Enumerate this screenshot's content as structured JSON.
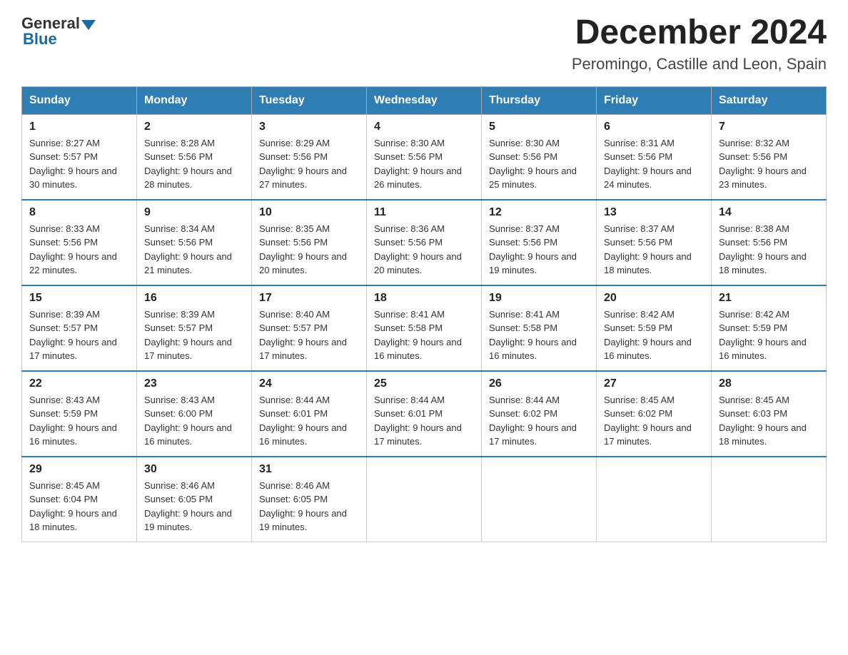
{
  "logo": {
    "general": "General",
    "blue": "Blue"
  },
  "title": "December 2024",
  "subtitle": "Peromingo, Castille and Leon, Spain",
  "days_of_week": [
    "Sunday",
    "Monday",
    "Tuesday",
    "Wednesday",
    "Thursday",
    "Friday",
    "Saturday"
  ],
  "weeks": [
    [
      {
        "day": "1",
        "sunrise": "8:27 AM",
        "sunset": "5:57 PM",
        "daylight": "9 hours and 30 minutes."
      },
      {
        "day": "2",
        "sunrise": "8:28 AM",
        "sunset": "5:56 PM",
        "daylight": "9 hours and 28 minutes."
      },
      {
        "day": "3",
        "sunrise": "8:29 AM",
        "sunset": "5:56 PM",
        "daylight": "9 hours and 27 minutes."
      },
      {
        "day": "4",
        "sunrise": "8:30 AM",
        "sunset": "5:56 PM",
        "daylight": "9 hours and 26 minutes."
      },
      {
        "day": "5",
        "sunrise": "8:30 AM",
        "sunset": "5:56 PM",
        "daylight": "9 hours and 25 minutes."
      },
      {
        "day": "6",
        "sunrise": "8:31 AM",
        "sunset": "5:56 PM",
        "daylight": "9 hours and 24 minutes."
      },
      {
        "day": "7",
        "sunrise": "8:32 AM",
        "sunset": "5:56 PM",
        "daylight": "9 hours and 23 minutes."
      }
    ],
    [
      {
        "day": "8",
        "sunrise": "8:33 AM",
        "sunset": "5:56 PM",
        "daylight": "9 hours and 22 minutes."
      },
      {
        "day": "9",
        "sunrise": "8:34 AM",
        "sunset": "5:56 PM",
        "daylight": "9 hours and 21 minutes."
      },
      {
        "day": "10",
        "sunrise": "8:35 AM",
        "sunset": "5:56 PM",
        "daylight": "9 hours and 20 minutes."
      },
      {
        "day": "11",
        "sunrise": "8:36 AM",
        "sunset": "5:56 PM",
        "daylight": "9 hours and 20 minutes."
      },
      {
        "day": "12",
        "sunrise": "8:37 AM",
        "sunset": "5:56 PM",
        "daylight": "9 hours and 19 minutes."
      },
      {
        "day": "13",
        "sunrise": "8:37 AM",
        "sunset": "5:56 PM",
        "daylight": "9 hours and 18 minutes."
      },
      {
        "day": "14",
        "sunrise": "8:38 AM",
        "sunset": "5:56 PM",
        "daylight": "9 hours and 18 minutes."
      }
    ],
    [
      {
        "day": "15",
        "sunrise": "8:39 AM",
        "sunset": "5:57 PM",
        "daylight": "9 hours and 17 minutes."
      },
      {
        "day": "16",
        "sunrise": "8:39 AM",
        "sunset": "5:57 PM",
        "daylight": "9 hours and 17 minutes."
      },
      {
        "day": "17",
        "sunrise": "8:40 AM",
        "sunset": "5:57 PM",
        "daylight": "9 hours and 17 minutes."
      },
      {
        "day": "18",
        "sunrise": "8:41 AM",
        "sunset": "5:58 PM",
        "daylight": "9 hours and 16 minutes."
      },
      {
        "day": "19",
        "sunrise": "8:41 AM",
        "sunset": "5:58 PM",
        "daylight": "9 hours and 16 minutes."
      },
      {
        "day": "20",
        "sunrise": "8:42 AM",
        "sunset": "5:59 PM",
        "daylight": "9 hours and 16 minutes."
      },
      {
        "day": "21",
        "sunrise": "8:42 AM",
        "sunset": "5:59 PM",
        "daylight": "9 hours and 16 minutes."
      }
    ],
    [
      {
        "day": "22",
        "sunrise": "8:43 AM",
        "sunset": "5:59 PM",
        "daylight": "9 hours and 16 minutes."
      },
      {
        "day": "23",
        "sunrise": "8:43 AM",
        "sunset": "6:00 PM",
        "daylight": "9 hours and 16 minutes."
      },
      {
        "day": "24",
        "sunrise": "8:44 AM",
        "sunset": "6:01 PM",
        "daylight": "9 hours and 16 minutes."
      },
      {
        "day": "25",
        "sunrise": "8:44 AM",
        "sunset": "6:01 PM",
        "daylight": "9 hours and 17 minutes."
      },
      {
        "day": "26",
        "sunrise": "8:44 AM",
        "sunset": "6:02 PM",
        "daylight": "9 hours and 17 minutes."
      },
      {
        "day": "27",
        "sunrise": "8:45 AM",
        "sunset": "6:02 PM",
        "daylight": "9 hours and 17 minutes."
      },
      {
        "day": "28",
        "sunrise": "8:45 AM",
        "sunset": "6:03 PM",
        "daylight": "9 hours and 18 minutes."
      }
    ],
    [
      {
        "day": "29",
        "sunrise": "8:45 AM",
        "sunset": "6:04 PM",
        "daylight": "9 hours and 18 minutes."
      },
      {
        "day": "30",
        "sunrise": "8:46 AM",
        "sunset": "6:05 PM",
        "daylight": "9 hours and 19 minutes."
      },
      {
        "day": "31",
        "sunrise": "8:46 AM",
        "sunset": "6:05 PM",
        "daylight": "9 hours and 19 minutes."
      },
      null,
      null,
      null,
      null
    ]
  ]
}
